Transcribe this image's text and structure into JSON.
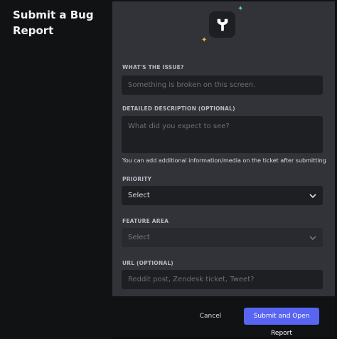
{
  "sidebar": {
    "title": "Submit a Bug Report"
  },
  "form": {
    "issue": {
      "label": "WHAT'S THE ISSUE?",
      "placeholder": "Something is broken on this screen."
    },
    "description": {
      "label": "DETAILED DESCRIPTION (OPTIONAL)",
      "placeholder": "What did you expect to see?",
      "hint": "You can add additional information/media on the ticket after submitting"
    },
    "priority": {
      "label": "PRIORITY",
      "value": "Select"
    },
    "feature_area": {
      "label": "FEATURE AREA",
      "value": "Select"
    },
    "url": {
      "label": "URL (OPTIONAL)",
      "placeholder": "Reddit post, Zendesk ticket, Tweet?"
    }
  },
  "footer": {
    "cancel_label": "Cancel",
    "submit_label": "Submit and Open Report"
  },
  "icons": {
    "hero": "wrench-icon",
    "sparkle_gold": "sparkle-icon",
    "sparkle_teal": "sparkle-icon",
    "chevron": "chevron-down-icon"
  },
  "colors": {
    "accent": "#5865f2",
    "panel": "#313338",
    "field": "#1e1f22",
    "background": "#111214"
  }
}
